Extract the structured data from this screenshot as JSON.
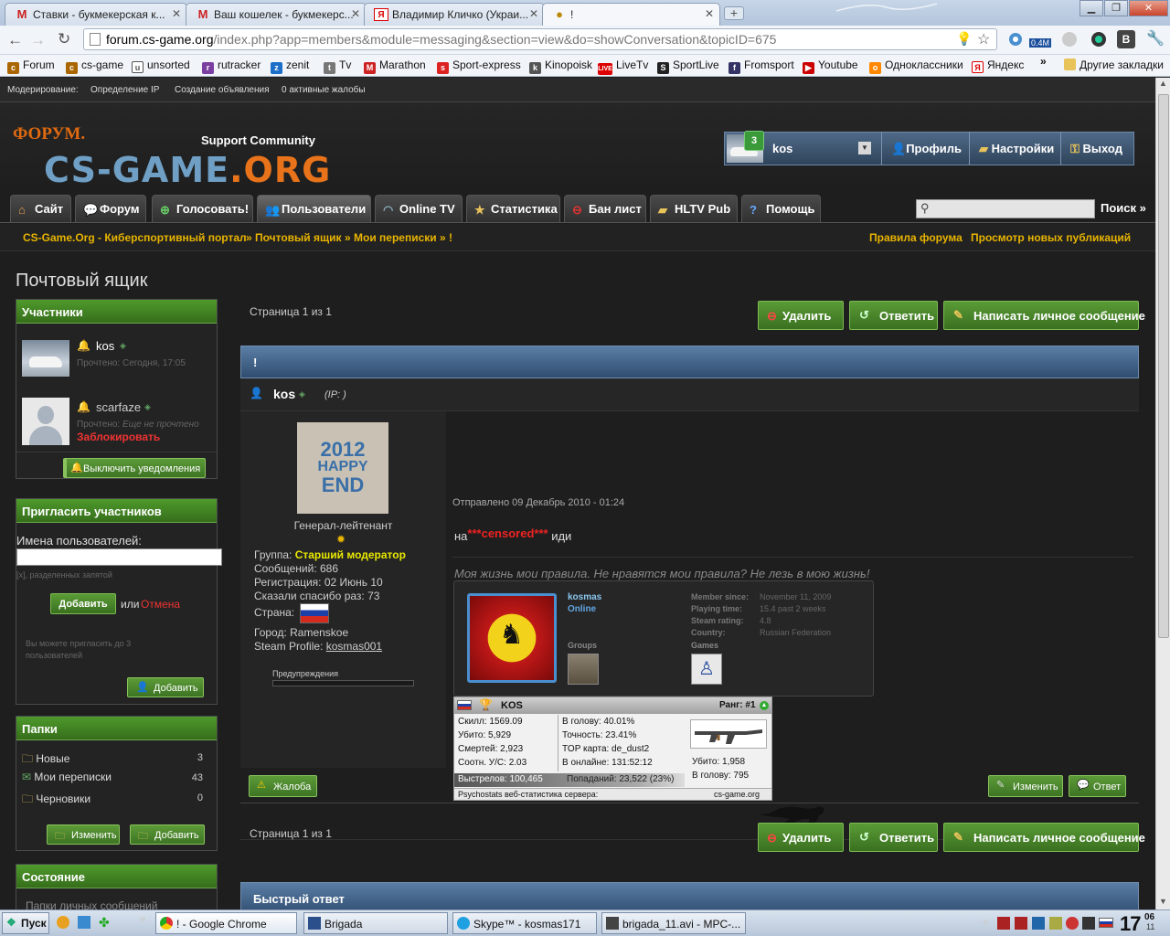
{
  "browser": {
    "tabs": [
      {
        "title": "Ставки - букмекерская к...",
        "icon": "gmail-icon"
      },
      {
        "title": "Ваш кошелек - букмекерс...",
        "icon": "gmail-icon"
      },
      {
        "title": "Владимир Кличко (Украи...",
        "icon": "yandex-icon"
      },
      {
        "title": "!",
        "icon": "cs-game-icon"
      }
    ],
    "url_host": "forum.cs-game.org",
    "url_path": "/index.php?app=members&module=messaging&section=view&do=showConversation&topicID=675",
    "ext_badge": "0.4M",
    "bookmarks": [
      "Forum",
      "cs-game",
      "unsorted",
      "rutracker",
      "zenit",
      "Tv",
      "Marathon",
      "Sport-express",
      "Kinopoisk",
      "LiveTv",
      "SportLive",
      "Fromsport",
      "Youtube",
      "Одноклассники",
      "Яндекс"
    ],
    "bookmarks_more": "»",
    "other_bookmarks": "Другие закладки"
  },
  "modbar": {
    "label": "Модерирование:",
    "links": [
      "Определение IP",
      "Создание объявления",
      "0 активные жалобы"
    ]
  },
  "header": {
    "logo_top": "ФОРУМ.",
    "logo_support": "Support Community",
    "logo_main": "CS-GAME",
    "logo_tld": ".ORG",
    "user": {
      "name": "kos",
      "notif_count": "3"
    },
    "links": [
      "Профиль",
      "Настройки",
      "Выход"
    ]
  },
  "nav": {
    "tabs": [
      "Сайт",
      "Форум",
      "Голосовать!",
      "Пользователи",
      "Online TV",
      "Статистика",
      "Бан лист",
      "HLTV Pub",
      "Помощь"
    ],
    "search_label": "Поиск »"
  },
  "breadcrumb": {
    "items": [
      "CS-Game.Org - Киберспортивный портал",
      "» Почтовый ящик",
      "» Мои переписки",
      "» !"
    ],
    "right": [
      "Правила форума",
      "Просмотр новых публикаций"
    ]
  },
  "page_title": "Почтовый ящик",
  "participants": {
    "title": "Участники",
    "users": [
      {
        "name": "kos",
        "status": "Прочтено: Сегодня, 17:05"
      },
      {
        "name": "scarfaze",
        "status_label": "Прочтено: ",
        "status_value": "Еще не прочтено",
        "blocked": "Заблокировать"
      }
    ],
    "notify_btn": "Выключить уведомления"
  },
  "invite": {
    "title": "Пригласить участников",
    "label": "Имена пользователей:",
    "hint": "[x], разделенных запятой",
    "add_btn": "Добавить",
    "or": "или",
    "cancel": "Отмена",
    "limit": "Вы можете пригласить до 3 пользователей",
    "add_btn2": "Добавить"
  },
  "folders": {
    "title": "Папки",
    "items": [
      {
        "name": "Новые",
        "count": "3"
      },
      {
        "name": "Мои переписки",
        "count": "43"
      },
      {
        "name": "Черновики",
        "count": "0"
      }
    ],
    "edit_btn": "Изменить",
    "add_btn": "Добавить"
  },
  "state": {
    "title": "Состояние",
    "text": "Папки личных сообщений"
  },
  "conversation": {
    "pager": "Страница 1 из 1",
    "buttons": {
      "delete": "Удалить",
      "reply": "Ответить",
      "compose": "Написать личное сообщение"
    },
    "title": "!",
    "author": {
      "name": "kos",
      "ip": "(IP: )",
      "rank_title": "Генерал-лейтенант",
      "group_label": "Группа:",
      "group": "Старший модератор",
      "posts": "Сообщений: 686",
      "reg": "Регистрация: 02 Июнь 10",
      "thanks": "Сказали спасибо раз: 73",
      "country_label": "Страна:",
      "city": "Город: Ramenskoe",
      "steam_label": "Steam Profile:",
      "steam": "kosmas001",
      "warnings": "Предупреждения",
      "avatar_text": [
        "2012",
        "HAPPY",
        "END"
      ]
    },
    "post": {
      "date": "Отправлено 09 Декабрь 2010 - 01:24",
      "text_before": "на",
      "censored": "***censored***",
      "text_after": "иди",
      "signature": "Моя жизнь мои правила. Не нравятся мои правила? Не лезь в мою жизнь!"
    },
    "steam": {
      "name": "kosmas",
      "status": "Online",
      "groups": "Groups",
      "games": "Games",
      "fields": [
        {
          "k": "Member since:",
          "v": "November 11, 2009"
        },
        {
          "k": "Playing time:",
          "v": "15.4 past 2 weeks"
        },
        {
          "k": "Steam rating:",
          "v": "4.8"
        },
        {
          "k": "Country:",
          "v": "Russian Federation"
        }
      ]
    },
    "stats": {
      "name": "KOS",
      "rank": "Ранг: #1",
      "left": [
        "Скилл: 1569.09",
        "Убито: 5,929",
        "Смертей: 2,923",
        "Соотн. У/С: 2.03"
      ],
      "mid": [
        "В голову: 40.01%",
        "Точность: 23.41%",
        "TOP карта: de_dust2",
        "В онлайне: 131:52:12"
      ],
      "right": [
        "Убито: 1,958",
        "В голову: 795"
      ],
      "shots": "Выстрелов: 100,465",
      "hits": "Попаданий: 23,522 (23%)",
      "footer_left": "Psychostats веб-статистика сервера:",
      "footer_right": "cs-game.org"
    },
    "report_btn": "Жалоба",
    "edit_btn": "Изменить",
    "reply_btn": "Ответ",
    "quick_reply": "Быстрый ответ"
  },
  "taskbar": {
    "start": "Пуск",
    "items": [
      "! - Google Chrome",
      "Brigada",
      "Skype™ - kosmas171",
      "brigada_11.avi - MPC-..."
    ],
    "time": "17",
    "time_small_top": "06",
    "time_small_bottom": "11"
  }
}
